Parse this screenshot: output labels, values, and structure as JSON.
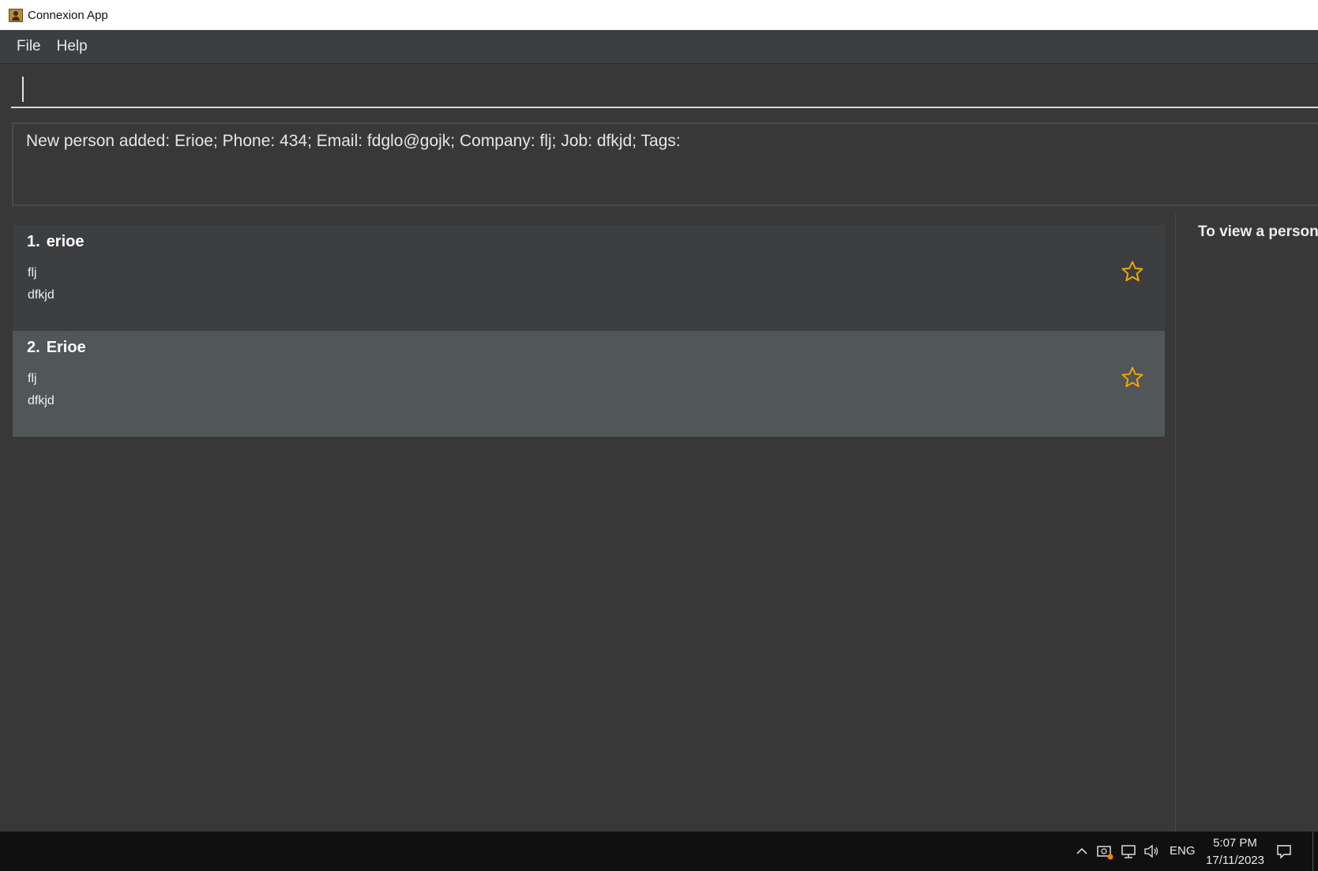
{
  "window": {
    "title": "Connexion App"
  },
  "menu": {
    "items": [
      "File",
      "Help"
    ]
  },
  "command": {
    "value": "",
    "placeholder": ""
  },
  "result": {
    "text": "New person added: Erioe; Phone: 434; Email: fdglo@gojk; Company: flj; Job: dfkjd; Tags:"
  },
  "persons": [
    {
      "index": "1.",
      "name": "erioe",
      "company": "flj",
      "job": "dfkjd",
      "starred": false,
      "icon": "star-outline-icon"
    },
    {
      "index": "2.",
      "name": "Erioe",
      "company": "flj",
      "job": "dfkjd",
      "starred": false,
      "icon": "star-outline-icon",
      "selected": true
    }
  ],
  "detail": {
    "text": "To view a person"
  },
  "taskbar": {
    "language": "ENG",
    "time": "5:07 PM",
    "date": "17/11/2023",
    "icons": [
      "chevron-up-icon",
      "meet-now-icon",
      "network-icon",
      "volume-icon",
      "notifications-icon"
    ]
  },
  "colors": {
    "star": "#f0a500",
    "background": "#383838",
    "selected_card": "#515658"
  }
}
